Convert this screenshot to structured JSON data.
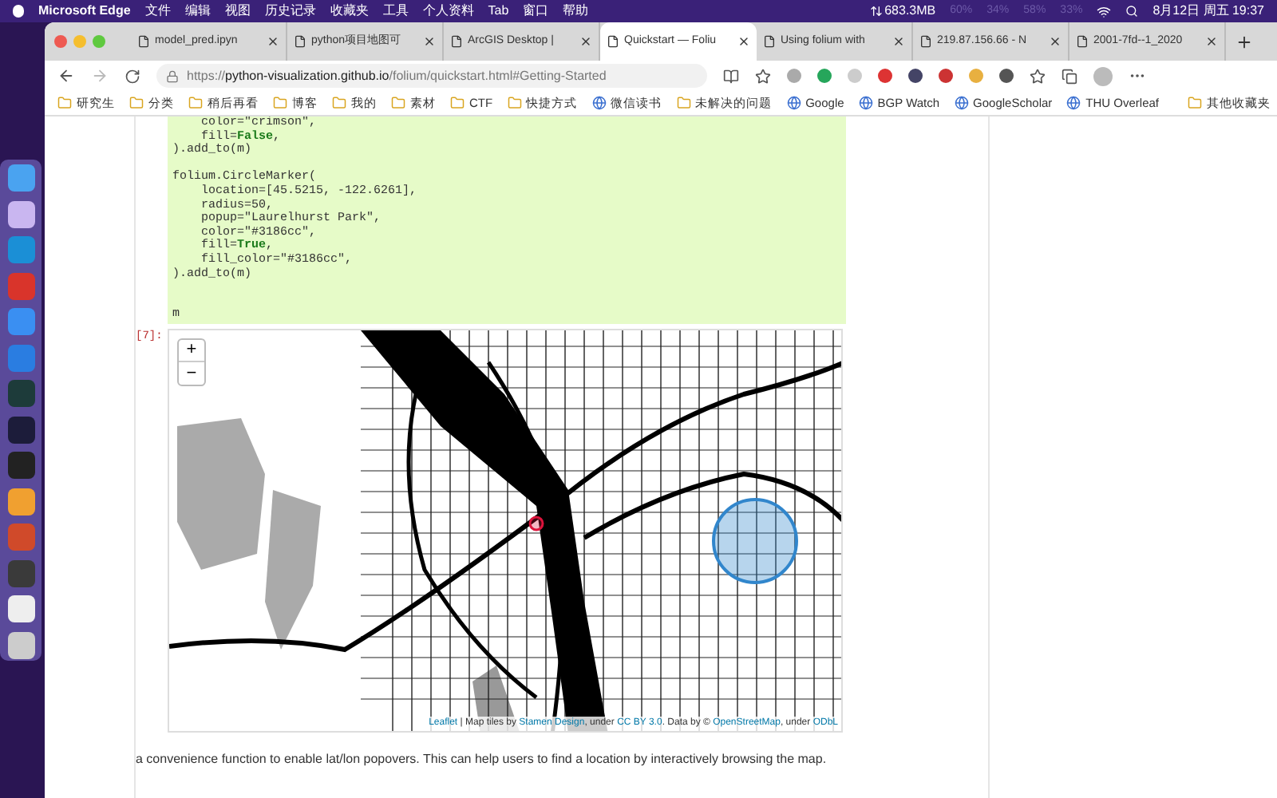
{
  "menu_bar": {
    "app": "Microsoft Edge",
    "items": [
      "文件",
      "编辑",
      "视图",
      "历史记录",
      "收藏夹",
      "工具",
      "个人资料",
      "Tab",
      "窗口",
      "帮助"
    ],
    "network": "683.3MB",
    "meters": [
      "60%",
      "34%",
      "58%",
      "33%"
    ],
    "datetime": "8月12日 周五 19:37"
  },
  "tabs": [
    {
      "label": "model_pred.ipyn",
      "selected": false
    },
    {
      "label": "python项目地图可",
      "selected": false
    },
    {
      "label": "ArcGIS Desktop |",
      "selected": false
    },
    {
      "label": "Quickstart — Foliu",
      "selected": true
    },
    {
      "label": "Using folium with",
      "selected": false
    },
    {
      "label": "219.87.156.66 - N",
      "selected": false
    },
    {
      "label": "2001-7fd--1_2020",
      "selected": false
    }
  ],
  "address_bar": {
    "url": "https://**python-visualization.github.io**/folium/quickstart.html#Getting-Started"
  },
  "bookmarks": [
    {
      "label": "研究生",
      "kind": "folder"
    },
    {
      "label": "分类",
      "kind": "folder"
    },
    {
      "label": "稍后再看",
      "kind": "folder"
    },
    {
      "label": "博客",
      "kind": "folder"
    },
    {
      "label": "我的",
      "kind": "folder"
    },
    {
      "label": "素材",
      "kind": "folder"
    },
    {
      "label": "CTF",
      "kind": "folder"
    },
    {
      "label": "快捷方式",
      "kind": "folder"
    },
    {
      "label": "微信读书",
      "kind": "site"
    },
    {
      "label": "未解决的问题",
      "kind": "folder"
    },
    {
      "label": "Google",
      "kind": "site"
    },
    {
      "label": "BGP Watch",
      "kind": "site"
    },
    {
      "label": "GoogleScholar",
      "kind": "site"
    },
    {
      "label": "THU Overleaf",
      "kind": "site"
    }
  ],
  "other_bookmarks": "其他收藏夹",
  "code_blocks": [
    [
      "    color=\"crimson\",",
      "    fill=**False**,",
      ").add_to(m)"
    ],
    [
      "folium.CircleMarker(",
      "    location=[45.5215, -122.6261],",
      "    radius=50,",
      "    popup=\"Laurelhurst Park\",",
      "    color=\"#3186cc\",",
      "    fill=**True**,",
      "    fill_color=\"#3186cc\",",
      ").add_to(m)"
    ],
    [
      "m"
    ]
  ],
  "output_prompt": "[7]:",
  "map": {
    "zoom_in": "+",
    "zoom_out": "−",
    "attribution": [
      {
        "text": "Leaflet",
        "link": true
      },
      {
        "text": " | Map tiles by ",
        "link": false
      },
      {
        "text": "Stamen Design",
        "link": true
      },
      {
        "text": ", under ",
        "link": false
      },
      {
        "text": "CC BY 3.0",
        "link": true
      },
      {
        "text": ". Data by © ",
        "link": false
      },
      {
        "text": "OpenStreetMap",
        "link": true
      },
      {
        "text": ", under ",
        "link": false
      },
      {
        "text": "ODbL",
        "link": true
      }
    ]
  },
  "paragraph": "a convenience function to enable lat/lon popovers. This can help users to find a location by interactively browsing the map."
}
